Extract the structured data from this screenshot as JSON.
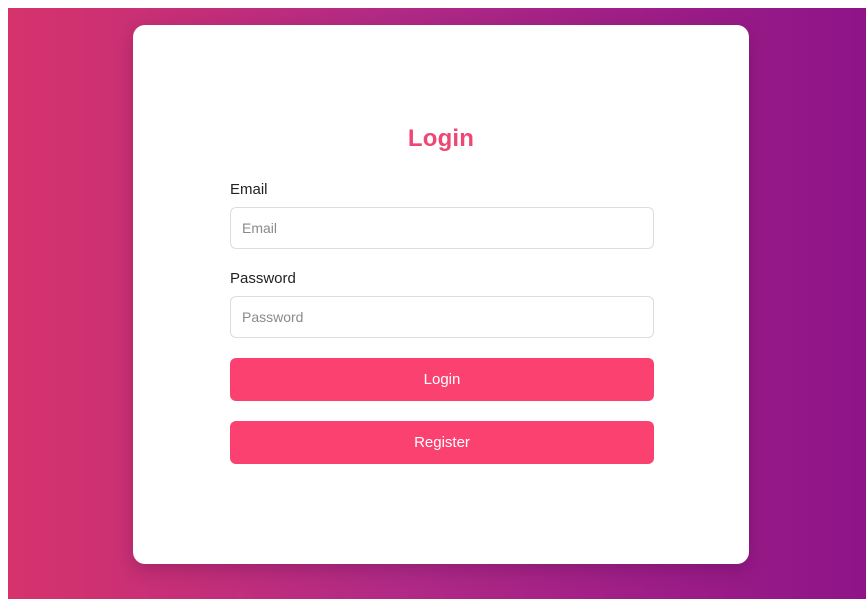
{
  "login_form": {
    "title": "Login",
    "email": {
      "label": "Email",
      "placeholder": "Email",
      "value": ""
    },
    "password": {
      "label": "Password",
      "placeholder": "Password",
      "value": ""
    },
    "login_button_label": "Login",
    "register_button_label": "Register"
  },
  "colors": {
    "accent": "#fa4170",
    "title": "#ef4673",
    "background_gradient_start": "#d6336c",
    "background_gradient_end": "#8e1488",
    "card": "#ffffff"
  }
}
